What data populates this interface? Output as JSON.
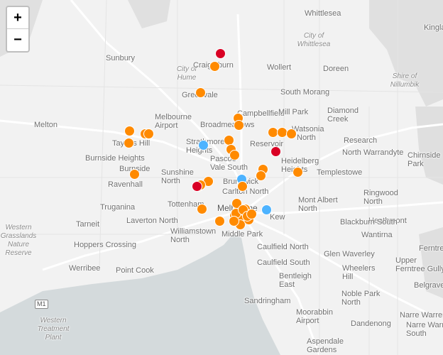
{
  "map": {
    "colors": {
      "land": "#f2f2f2",
      "water": "#d4dadc",
      "terrain": "#dcdcdc",
      "road": "#ffffff",
      "marker_orange": "#ff8a00",
      "marker_blue": "#4db3ff",
      "marker_red": "#d90024"
    },
    "zoom": {
      "in_label": "+",
      "out_label": "−"
    },
    "highway_shield": "M1",
    "labels": [
      {
        "text": "Whittlesea",
        "kind": "place"
      },
      {
        "text": "Kingla",
        "kind": "place"
      },
      {
        "text": "Sunbury",
        "kind": "place"
      },
      {
        "text": "City of Whittlesea",
        "kind": "region"
      },
      {
        "text": "City of Hume",
        "kind": "region"
      },
      {
        "text": "Craigieburn",
        "kind": "place"
      },
      {
        "text": "Wollert",
        "kind": "place"
      },
      {
        "text": "Doreen",
        "kind": "place"
      },
      {
        "text": "Shire of Nillumbik",
        "kind": "region"
      },
      {
        "text": "Greenvale",
        "kind": "place"
      },
      {
        "text": "South Morang",
        "kind": "place"
      },
      {
        "text": "Campbellfield",
        "kind": "place"
      },
      {
        "text": "Mill Park",
        "kind": "place"
      },
      {
        "text": "Diamond Creek",
        "kind": "place"
      },
      {
        "text": "Melbourne Airport",
        "kind": "place"
      },
      {
        "text": "Broadmeadows",
        "kind": "place"
      },
      {
        "text": "Watsonia",
        "kind": "place"
      },
      {
        "text": "Melton",
        "kind": "place"
      },
      {
        "text": "Taylors Hill",
        "kind": "place"
      },
      {
        "text": "Strathmore Heights",
        "kind": "place"
      },
      {
        "text": "Reservoir",
        "kind": "place"
      },
      {
        "text": "North",
        "kind": "place"
      },
      {
        "text": "Research",
        "kind": "place"
      },
      {
        "text": "Burnside Heights",
        "kind": "place"
      },
      {
        "text": "Pascoe Vale South",
        "kind": "place"
      },
      {
        "text": "Heidelberg Heights",
        "kind": "place"
      },
      {
        "text": "North Warrandyte",
        "kind": "place"
      },
      {
        "text": "Chirnside Park",
        "kind": "place"
      },
      {
        "text": "Burnside",
        "kind": "place"
      },
      {
        "text": "Sunshine North",
        "kind": "place"
      },
      {
        "text": "Templestowe",
        "kind": "place"
      },
      {
        "text": "Ravenhall",
        "kind": "place"
      },
      {
        "text": "Brunswick",
        "kind": "place"
      },
      {
        "text": "Carlton North",
        "kind": "place"
      },
      {
        "text": "Mont Albert North",
        "kind": "place"
      },
      {
        "text": "Ringwood North",
        "kind": "place"
      },
      {
        "text": "Truganina",
        "kind": "place"
      },
      {
        "text": "Tottenham",
        "kind": "place"
      },
      {
        "text": "Melbourne",
        "kind": "city"
      },
      {
        "text": "Kew",
        "kind": "place"
      },
      {
        "text": "Heathmont",
        "kind": "place"
      },
      {
        "text": "Tarneit",
        "kind": "place"
      },
      {
        "text": "Laverton North",
        "kind": "place"
      },
      {
        "text": "Blackburn South",
        "kind": "place"
      },
      {
        "text": "Wantirna",
        "kind": "place"
      },
      {
        "text": "Western Grasslands Nature Reserve",
        "kind": "region"
      },
      {
        "text": "Williamstown North",
        "kind": "place"
      },
      {
        "text": "Middle Park",
        "kind": "place"
      },
      {
        "text": "Hoppers Crossing",
        "kind": "place"
      },
      {
        "text": "Caulfield North",
        "kind": "place"
      },
      {
        "text": "Glen Waverley",
        "kind": "place"
      },
      {
        "text": "Ferntree",
        "kind": "place"
      },
      {
        "text": "Werribee",
        "kind": "place"
      },
      {
        "text": "Point Cook",
        "kind": "place"
      },
      {
        "text": "Caulfield South",
        "kind": "place"
      },
      {
        "text": "Wheelers Hill",
        "kind": "place"
      },
      {
        "text": "Upper Ferntree Gully",
        "kind": "place"
      },
      {
        "text": "Bentleigh East",
        "kind": "place"
      },
      {
        "text": "Belgrave",
        "kind": "place"
      },
      {
        "text": "Noble Park North",
        "kind": "place"
      },
      {
        "text": "Sandringham",
        "kind": "place"
      },
      {
        "text": "Moorabbin Airport",
        "kind": "place"
      },
      {
        "text": "Narre Warren",
        "kind": "place"
      },
      {
        "text": "Western Treatment Plant",
        "kind": "region"
      },
      {
        "text": "Dandenong",
        "kind": "place"
      },
      {
        "text": "Narre Warren South",
        "kind": "place"
      },
      {
        "text": "Aspendale Gardens",
        "kind": "place"
      }
    ],
    "markers": [
      {
        "color": "red"
      },
      {
        "color": "orange"
      },
      {
        "color": "orange"
      },
      {
        "color": "orange"
      },
      {
        "color": "orange"
      },
      {
        "color": "orange"
      },
      {
        "color": "orange"
      },
      {
        "color": "orange"
      },
      {
        "color": "orange"
      },
      {
        "color": "orange"
      },
      {
        "color": "orange"
      },
      {
        "color": "orange"
      },
      {
        "color": "orange"
      },
      {
        "color": "blue"
      },
      {
        "color": "orange"
      },
      {
        "color": "orange"
      },
      {
        "color": "red"
      },
      {
        "color": "orange"
      },
      {
        "color": "orange"
      },
      {
        "color": "orange"
      },
      {
        "color": "orange"
      },
      {
        "color": "blue"
      },
      {
        "color": "orange"
      },
      {
        "color": "orange"
      },
      {
        "color": "orange"
      },
      {
        "color": "orange"
      },
      {
        "color": "red"
      },
      {
        "color": "orange"
      },
      {
        "color": "orange"
      },
      {
        "color": "orange"
      },
      {
        "color": "orange"
      },
      {
        "color": "blue"
      },
      {
        "color": "orange"
      },
      {
        "color": "orange"
      },
      {
        "color": "orange"
      },
      {
        "color": "orange"
      },
      {
        "color": "orange"
      },
      {
        "color": "orange"
      },
      {
        "color": "orange"
      },
      {
        "color": "orange"
      },
      {
        "color": "orange"
      },
      {
        "color": "orange"
      },
      {
        "color": "orange"
      },
      {
        "color": "orange"
      }
    ]
  }
}
